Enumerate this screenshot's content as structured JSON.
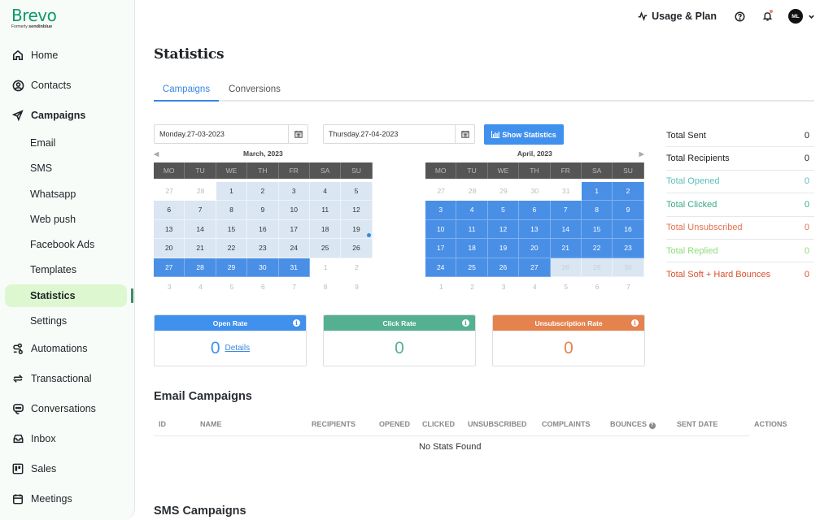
{
  "brand": {
    "name": "Brevo",
    "formerly_label": "Formerly",
    "formerly_name": "sendinblue",
    "color": "#0b996e"
  },
  "sidebar": {
    "items": [
      {
        "label": "Home",
        "icon": "home-icon"
      },
      {
        "label": "Contacts",
        "icon": "contacts-icon"
      },
      {
        "label": "Campaigns",
        "icon": "paper-plane-icon"
      },
      {
        "label": "Email"
      },
      {
        "label": "SMS"
      },
      {
        "label": "Whatsapp"
      },
      {
        "label": "Web push"
      },
      {
        "label": "Facebook Ads"
      },
      {
        "label": "Templates"
      },
      {
        "label": "Statistics",
        "active": true
      },
      {
        "label": "Settings"
      },
      {
        "label": "Automations",
        "icon": "automations-icon"
      },
      {
        "label": "Transactional",
        "icon": "transactional-icon"
      },
      {
        "label": "Conversations",
        "icon": "conversations-icon"
      },
      {
        "label": "Inbox",
        "icon": "inbox-icon"
      },
      {
        "label": "Sales",
        "icon": "sales-icon"
      },
      {
        "label": "Meetings",
        "icon": "calendar-icon"
      }
    ]
  },
  "topbar": {
    "usage_label": "Usage & Plan",
    "avatar_initials": "ML"
  },
  "page": {
    "title": "Statistics",
    "tabs": [
      {
        "label": "Campaigns",
        "active": true
      },
      {
        "label": "Conversions"
      }
    ]
  },
  "filters": {
    "start_date": "Monday.27-03-2023",
    "end_date": "Thursday.27-04-2023",
    "show_button": "Show Statistics"
  },
  "calendars": [
    {
      "title": "March, 2023",
      "weekdays": [
        "MO",
        "TU",
        "WE",
        "TH",
        "FR",
        "SA",
        "SU"
      ],
      "days": [
        {
          "d": "27",
          "s": "muted"
        },
        {
          "d": "28",
          "s": "muted"
        },
        {
          "d": "1",
          "s": "range"
        },
        {
          "d": "2",
          "s": "range"
        },
        {
          "d": "3",
          "s": "range"
        },
        {
          "d": "4",
          "s": "range"
        },
        {
          "d": "5",
          "s": "range"
        },
        {
          "d": "6",
          "s": "range"
        },
        {
          "d": "7",
          "s": "range"
        },
        {
          "d": "8",
          "s": "range"
        },
        {
          "d": "9",
          "s": "range"
        },
        {
          "d": "10",
          "s": "range"
        },
        {
          "d": "11",
          "s": "range"
        },
        {
          "d": "12",
          "s": "range"
        },
        {
          "d": "13",
          "s": "range"
        },
        {
          "d": "14",
          "s": "range"
        },
        {
          "d": "15",
          "s": "range"
        },
        {
          "d": "16",
          "s": "range"
        },
        {
          "d": "17",
          "s": "range"
        },
        {
          "d": "18",
          "s": "range"
        },
        {
          "d": "19",
          "s": "range"
        },
        {
          "d": "20",
          "s": "range"
        },
        {
          "d": "21",
          "s": "range"
        },
        {
          "d": "22",
          "s": "range"
        },
        {
          "d": "23",
          "s": "range"
        },
        {
          "d": "24",
          "s": "range"
        },
        {
          "d": "25",
          "s": "range"
        },
        {
          "d": "26",
          "s": "range"
        },
        {
          "d": "27",
          "s": "sel"
        },
        {
          "d": "28",
          "s": "sel"
        },
        {
          "d": "29",
          "s": "sel"
        },
        {
          "d": "30",
          "s": "sel"
        },
        {
          "d": "31",
          "s": "sel"
        },
        {
          "d": "1",
          "s": "muted"
        },
        {
          "d": "2",
          "s": "muted"
        },
        {
          "d": "3",
          "s": "muted"
        },
        {
          "d": "4",
          "s": "muted"
        },
        {
          "d": "5",
          "s": "muted"
        },
        {
          "d": "6",
          "s": "muted"
        },
        {
          "d": "7",
          "s": "muted"
        },
        {
          "d": "8",
          "s": "muted"
        },
        {
          "d": "9",
          "s": "muted"
        }
      ]
    },
    {
      "title": "April, 2023",
      "weekdays": [
        "MO",
        "TU",
        "WE",
        "TH",
        "FR",
        "SA",
        "SU"
      ],
      "days": [
        {
          "d": "27",
          "s": "muted"
        },
        {
          "d": "28",
          "s": "muted"
        },
        {
          "d": "29",
          "s": "muted"
        },
        {
          "d": "30",
          "s": "muted"
        },
        {
          "d": "31",
          "s": "muted"
        },
        {
          "d": "1",
          "s": "sel"
        },
        {
          "d": "2",
          "s": "sel"
        },
        {
          "d": "3",
          "s": "sel"
        },
        {
          "d": "4",
          "s": "sel"
        },
        {
          "d": "5",
          "s": "sel"
        },
        {
          "d": "6",
          "s": "sel"
        },
        {
          "d": "7",
          "s": "sel"
        },
        {
          "d": "8",
          "s": "sel"
        },
        {
          "d": "9",
          "s": "sel"
        },
        {
          "d": "10",
          "s": "sel"
        },
        {
          "d": "11",
          "s": "sel"
        },
        {
          "d": "12",
          "s": "sel"
        },
        {
          "d": "13",
          "s": "sel"
        },
        {
          "d": "14",
          "s": "sel"
        },
        {
          "d": "15",
          "s": "sel"
        },
        {
          "d": "16",
          "s": "sel"
        },
        {
          "d": "17",
          "s": "sel"
        },
        {
          "d": "18",
          "s": "sel"
        },
        {
          "d": "19",
          "s": "sel"
        },
        {
          "d": "20",
          "s": "sel"
        },
        {
          "d": "21",
          "s": "sel"
        },
        {
          "d": "22",
          "s": "sel"
        },
        {
          "d": "23",
          "s": "sel"
        },
        {
          "d": "24",
          "s": "sel"
        },
        {
          "d": "25",
          "s": "sel"
        },
        {
          "d": "26",
          "s": "sel"
        },
        {
          "d": "27",
          "s": "sel"
        },
        {
          "d": "28",
          "s": "range muted"
        },
        {
          "d": "29",
          "s": "range muted"
        },
        {
          "d": "30",
          "s": "range muted"
        },
        {
          "d": "1",
          "s": "muted"
        },
        {
          "d": "2",
          "s": "muted"
        },
        {
          "d": "3",
          "s": "muted"
        },
        {
          "d": "4",
          "s": "muted"
        },
        {
          "d": "5",
          "s": "muted"
        },
        {
          "d": "6",
          "s": "muted"
        },
        {
          "d": "7",
          "s": "muted"
        }
      ]
    }
  ],
  "totals": [
    {
      "label": "Total Sent",
      "value": "0",
      "color": "#222222"
    },
    {
      "label": "Total Recipients",
      "value": "0",
      "color": "#222222"
    },
    {
      "label": "Total Opened",
      "value": "0",
      "color": "#5bbcb8"
    },
    {
      "label": "Total Clicked",
      "value": "0",
      "color": "#3aa88a"
    },
    {
      "label": "Total Unsubscribed",
      "value": "0",
      "color": "#e4734f"
    },
    {
      "label": "Total Replied",
      "value": "0",
      "color": "#8fdc7a"
    },
    {
      "label": "Total Soft + Hard Bounces",
      "value": "0",
      "color": "#d9502e"
    }
  ],
  "rates": [
    {
      "label": "Open Rate",
      "value": "0",
      "link": "Details",
      "color": "#4090ee"
    },
    {
      "label": "Click Rate",
      "value": "0",
      "color": "#55b092"
    },
    {
      "label": "Unsubscription Rate",
      "value": "0",
      "color": "#e5834f"
    }
  ],
  "email_campaigns": {
    "title": "Email Campaigns",
    "columns": [
      "ID",
      "NAME",
      "RECIPIENTS",
      "OPENED",
      "CLICKED",
      "UNSUBSCRIBED",
      "COMPLAINTS",
      "BOUNCES",
      "SENT DATE",
      "ACTIONS"
    ],
    "empty_message": "No Stats Found"
  },
  "sms_campaigns": {
    "title": "SMS Campaigns"
  }
}
